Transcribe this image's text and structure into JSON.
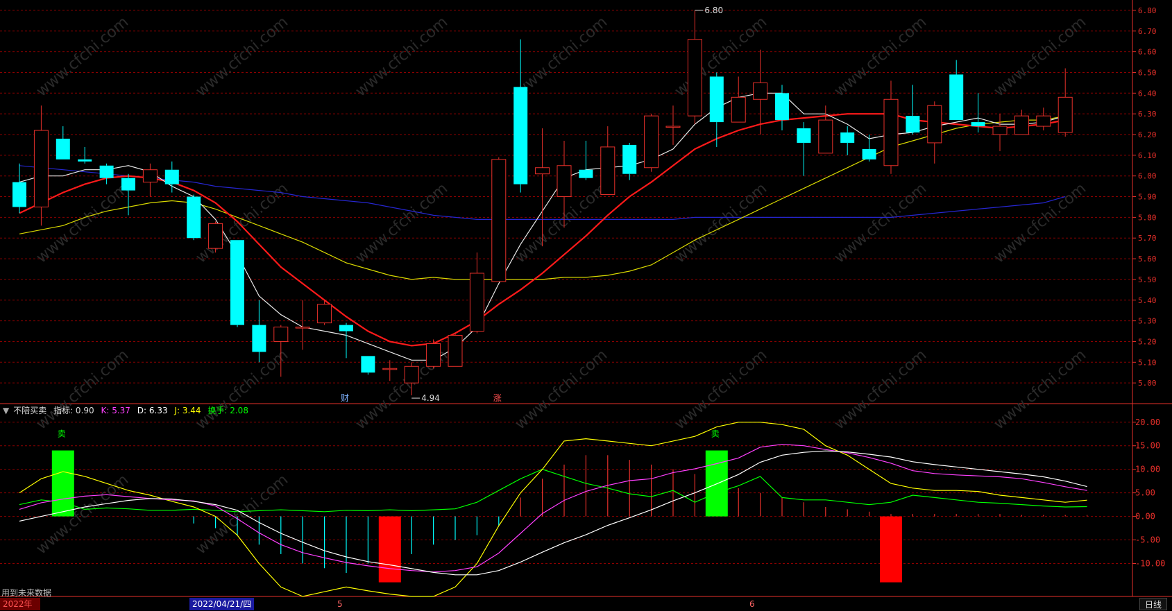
{
  "chart_data": [
    {
      "type": "candlestick",
      "ylim": [
        4.9,
        6.85
      ],
      "y_ticks": [
        5.0,
        5.1,
        5.2,
        5.3,
        5.4,
        5.5,
        5.6,
        5.7,
        5.8,
        5.9,
        6.0,
        6.1,
        6.2,
        6.3,
        6.4,
        6.5,
        6.6,
        6.7,
        6.8
      ],
      "candles": [
        {
          "o": 5.97,
          "h": 6.06,
          "l": 5.82,
          "c": 5.85
        },
        {
          "o": 5.85,
          "h": 6.34,
          "l": 5.76,
          "c": 6.22
        },
        {
          "o": 6.18,
          "h": 6.24,
          "l": 6.08,
          "c": 6.08
        },
        {
          "o": 6.08,
          "h": 6.14,
          "l": 6.06,
          "c": 6.07
        },
        {
          "o": 6.05,
          "h": 6.06,
          "l": 5.96,
          "c": 5.99
        },
        {
          "o": 5.99,
          "h": 6.01,
          "l": 5.81,
          "c": 5.93
        },
        {
          "o": 5.97,
          "h": 6.06,
          "l": 5.9,
          "c": 6.03
        },
        {
          "o": 6.03,
          "h": 6.07,
          "l": 5.92,
          "c": 5.96
        },
        {
          "o": 5.9,
          "h": 5.91,
          "l": 5.69,
          "c": 5.7
        },
        {
          "o": 5.65,
          "h": 5.78,
          "l": 5.63,
          "c": 5.77
        },
        {
          "o": 5.69,
          "h": 5.69,
          "l": 5.27,
          "c": 5.28
        },
        {
          "o": 5.28,
          "h": 5.4,
          "l": 5.1,
          "c": 5.15
        },
        {
          "o": 5.2,
          "h": 5.28,
          "l": 5.03,
          "c": 5.27
        },
        {
          "o": 5.27,
          "h": 5.4,
          "l": 5.16,
          "c": 5.27
        },
        {
          "o": 5.29,
          "h": 5.4,
          "l": 5.28,
          "c": 5.38
        },
        {
          "o": 5.28,
          "h": 5.29,
          "l": 5.12,
          "c": 5.25
        },
        {
          "o": 5.13,
          "h": 5.13,
          "l": 5.04,
          "c": 5.05
        },
        {
          "o": 5.07,
          "h": 5.11,
          "l": 5.01,
          "c": 5.07
        },
        {
          "o": 5.0,
          "h": 5.1,
          "l": 4.94,
          "c": 5.08
        },
        {
          "o": 5.08,
          "h": 5.21,
          "l": 5.07,
          "c": 5.19
        },
        {
          "o": 5.08,
          "h": 5.24,
          "l": 5.08,
          "c": 5.23
        },
        {
          "o": 5.25,
          "h": 5.63,
          "l": 5.24,
          "c": 5.53
        },
        {
          "o": 5.49,
          "h": 6.09,
          "l": 5.49,
          "c": 6.08
        },
        {
          "o": 6.43,
          "h": 6.66,
          "l": 5.92,
          "c": 5.96
        },
        {
          "o": 6.01,
          "h": 6.23,
          "l": 5.66,
          "c": 6.04
        },
        {
          "o": 5.9,
          "h": 6.17,
          "l": 5.75,
          "c": 6.05
        },
        {
          "o": 6.03,
          "h": 6.17,
          "l": 5.98,
          "c": 5.99
        },
        {
          "o": 5.91,
          "h": 6.24,
          "l": 5.91,
          "c": 6.14
        },
        {
          "o": 6.15,
          "h": 6.16,
          "l": 5.98,
          "c": 6.01
        },
        {
          "o": 6.04,
          "h": 6.3,
          "l": 6.02,
          "c": 6.29
        },
        {
          "o": 6.24,
          "h": 6.34,
          "l": 6.15,
          "c": 6.24
        },
        {
          "o": 6.29,
          "h": 6.8,
          "l": 6.25,
          "c": 6.66
        },
        {
          "o": 6.48,
          "h": 6.5,
          "l": 6.14,
          "c": 6.26
        },
        {
          "o": 6.26,
          "h": 6.48,
          "l": 6.26,
          "c": 6.38
        },
        {
          "o": 6.37,
          "h": 6.61,
          "l": 6.2,
          "c": 6.45
        },
        {
          "o": 6.4,
          "h": 6.44,
          "l": 6.22,
          "c": 6.27
        },
        {
          "o": 6.23,
          "h": 6.26,
          "l": 6.0,
          "c": 6.16
        },
        {
          "o": 6.11,
          "h": 6.34,
          "l": 6.11,
          "c": 6.27
        },
        {
          "o": 6.21,
          "h": 6.24,
          "l": 6.1,
          "c": 6.16
        },
        {
          "o": 6.13,
          "h": 6.2,
          "l": 6.07,
          "c": 6.08
        },
        {
          "o": 6.05,
          "h": 6.46,
          "l": 6.01,
          "c": 6.37
        },
        {
          "o": 6.29,
          "h": 6.44,
          "l": 6.2,
          "c": 6.21
        },
        {
          "o": 6.16,
          "h": 6.36,
          "l": 6.06,
          "c": 6.34
        },
        {
          "o": 6.49,
          "h": 6.56,
          "l": 6.27,
          "c": 6.27
        },
        {
          "o": 6.26,
          "h": 6.4,
          "l": 6.21,
          "c": 6.24
        },
        {
          "o": 6.2,
          "h": 6.3,
          "l": 6.12,
          "c": 6.24
        },
        {
          "o": 6.2,
          "h": 6.32,
          "l": 6.2,
          "c": 6.29
        },
        {
          "o": 6.24,
          "h": 6.33,
          "l": 6.22,
          "c": 6.29
        },
        {
          "o": 6.21,
          "h": 6.52,
          "l": 6.19,
          "c": 6.38
        }
      ],
      "ma_white": [
        5.97,
        6.0,
        6.0,
        6.03,
        6.03,
        6.05,
        6.02,
        5.95,
        5.9,
        5.79,
        5.62,
        5.42,
        5.33,
        5.27,
        5.25,
        5.23,
        5.19,
        5.15,
        5.11,
        5.11,
        5.17,
        5.27,
        5.48,
        5.67,
        5.83,
        5.99,
        6.03,
        6.04,
        6.05,
        6.08,
        6.13,
        6.25,
        6.33,
        6.38,
        6.4,
        6.4,
        6.3,
        6.3,
        6.25,
        6.18,
        6.2,
        6.21,
        6.24,
        6.26,
        6.28,
        6.25,
        6.25,
        6.26,
        6.29
      ],
      "ma_red": [
        5.82,
        5.87,
        5.92,
        5.96,
        5.99,
        6.0,
        5.99,
        5.97,
        5.93,
        5.87,
        5.78,
        5.67,
        5.56,
        5.48,
        5.4,
        5.32,
        5.25,
        5.2,
        5.18,
        5.19,
        5.24,
        5.3,
        5.38,
        5.45,
        5.53,
        5.62,
        5.71,
        5.81,
        5.9,
        5.97,
        6.05,
        6.13,
        6.18,
        6.22,
        6.25,
        6.27,
        6.28,
        6.29,
        6.3,
        6.3,
        6.3,
        6.27,
        6.26,
        6.25,
        6.24,
        6.23,
        6.24,
        6.25,
        6.27
      ],
      "ma_yellow": [
        5.72,
        5.74,
        5.76,
        5.8,
        5.83,
        5.85,
        5.87,
        5.88,
        5.87,
        5.84,
        5.8,
        5.76,
        5.72,
        5.68,
        5.63,
        5.58,
        5.55,
        5.52,
        5.5,
        5.51,
        5.5,
        5.5,
        5.5,
        5.5,
        5.5,
        5.51,
        5.51,
        5.52,
        5.54,
        5.57,
        5.63,
        5.69,
        5.74,
        5.79,
        5.84,
        5.89,
        5.94,
        5.99,
        6.04,
        6.09,
        6.14,
        6.17,
        6.2,
        6.23,
        6.25,
        6.26,
        6.27,
        6.27,
        6.29
      ],
      "ma_blue": [
        6.05,
        6.04,
        6.03,
        6.02,
        6.01,
        6.0,
        5.99,
        5.98,
        5.97,
        5.95,
        5.94,
        5.93,
        5.92,
        5.9,
        5.89,
        5.88,
        5.87,
        5.85,
        5.83,
        5.81,
        5.8,
        5.79,
        5.79,
        5.79,
        5.79,
        5.79,
        5.79,
        5.79,
        5.79,
        5.79,
        5.79,
        5.8,
        5.8,
        5.8,
        5.8,
        5.8,
        5.8,
        5.8,
        5.8,
        5.8,
        5.8,
        5.81,
        5.82,
        5.83,
        5.84,
        5.85,
        5.86,
        5.87,
        5.9
      ],
      "annotations": [
        {
          "label": "6.80",
          "index": 31
        },
        {
          "label": "4.94",
          "index": 18
        }
      ]
    },
    {
      "type": "indicator",
      "name": "不陪买卖",
      "ylim": [
        -17,
        21
      ],
      "y_ticks": [
        20.0,
        15.0,
        10.0,
        5.0,
        0.0,
        -5.0,
        -10.0
      ],
      "K": [
        1.5,
        2.9,
        3.7,
        4.3,
        4.6,
        4.2,
        3.8,
        3.5,
        3.3,
        2.2,
        -0.5,
        -3.5,
        -6.0,
        -7.7,
        -8.8,
        -9.8,
        -10.5,
        -11.1,
        -11.5,
        -11.8,
        -11.5,
        -10.7,
        -7.8,
        -3.6,
        0.6,
        3.4,
        5.3,
        6.6,
        7.6,
        8.0,
        9.3,
        10.1,
        11.2,
        12.4,
        14.7,
        15.3,
        15.0,
        14.2,
        13.5,
        12.5,
        11.3,
        9.7,
        9.1,
        8.8,
        8.6,
        8.4,
        8.0,
        7.2,
        6.3,
        5.5
      ],
      "D": [
        -1.0,
        0.0,
        1.0,
        2.0,
        2.7,
        3.4,
        3.8,
        3.7,
        3.2,
        2.5,
        1.3,
        -1.3,
        -3.6,
        -5.5,
        -7.3,
        -8.6,
        -9.6,
        -10.3,
        -11.1,
        -11.9,
        -12.4,
        -12.4,
        -11.5,
        -9.7,
        -7.6,
        -5.6,
        -3.9,
        -1.9,
        -0.3,
        1.4,
        3.3,
        5.0,
        6.9,
        8.9,
        11.5,
        13.0,
        13.6,
        13.9,
        13.7,
        13.2,
        12.6,
        11.6,
        11.0,
        10.5,
        10.0,
        9.5,
        9.0,
        8.4,
        7.5,
        6.33
      ],
      "J": [
        5.0,
        8.0,
        9.5,
        8.5,
        7.0,
        5.5,
        4.5,
        3.2,
        2.0,
        0.0,
        -4.0,
        -10.0,
        -15.0,
        -17.0,
        -16.0,
        -15.0,
        -15.8,
        -16.5,
        -17.0,
        -17.0,
        -15.0,
        -10.0,
        -2.0,
        5.0,
        10.0,
        16.0,
        16.5,
        16.0,
        15.5,
        15.0,
        16.0,
        17.0,
        19.0,
        20.0,
        20.0,
        19.5,
        18.5,
        15.0,
        13.0,
        10.0,
        7.0,
        6.0,
        5.5,
        5.5,
        5.3,
        4.5,
        4.0,
        3.5,
        3.0,
        3.44
      ],
      "turnover": [
        2.5,
        3.5,
        3.0,
        1.5,
        1.8,
        1.6,
        1.3,
        1.3,
        1.5,
        1.3,
        1.0,
        1.2,
        1.4,
        1.2,
        1.0,
        1.3,
        1.2,
        1.4,
        1.2,
        1.4,
        1.6,
        3.0,
        5.5,
        8.0,
        10.0,
        8.5,
        7.0,
        6.0,
        4.8,
        4.2,
        5.5,
        3.0,
        5.0,
        6.5,
        8.5,
        4.0,
        3.5,
        3.5,
        3.0,
        2.5,
        3.0,
        4.5,
        4.0,
        3.5,
        3.0,
        2.8,
        2.5,
        2.2,
        2.0,
        2.08
      ],
      "hist": [
        0,
        0,
        0,
        0,
        0,
        0,
        0,
        0,
        -1.5,
        -2.5,
        -4,
        -6,
        -8,
        -10,
        -11,
        -12,
        -10,
        -10,
        -8,
        -6,
        -5,
        -4,
        -2,
        4,
        8,
        11,
        13,
        13,
        12,
        11,
        10,
        9,
        7,
        6,
        5,
        4,
        3,
        2,
        1.5,
        1,
        0.5,
        0.5,
        0.5,
        0.5,
        0.5,
        0.5,
        0.3,
        0.3,
        0.3,
        0.3
      ],
      "signals": [
        {
          "type": "sell",
          "index": 2,
          "label": "卖"
        },
        {
          "type": "buy",
          "index": 17
        },
        {
          "type": "sell",
          "index": 32,
          "label": "卖"
        },
        {
          "type": "buy",
          "index": 40
        }
      ]
    }
  ],
  "legend": {
    "name": "不陪买卖",
    "indicator_label": "指标: 0.90",
    "k_label": "K: 5.37",
    "d_label": "D: 6.33",
    "j_label": "J: 3.44",
    "turnover_label": "换手: 2.08",
    "colors": {
      "K": "#ff40ff",
      "D": "#ffffff",
      "J": "#ffff00",
      "turnover": "#00ff00",
      "buy": "#ff0000",
      "sell": "#00ff00"
    }
  },
  "markers": [
    {
      "label": "财",
      "index": 15
    },
    {
      "label": "涨",
      "index": 22
    }
  ],
  "bottom_bar": {
    "year": "2022年",
    "date": "2022/04/21/四",
    "tick_5": "5",
    "tick_6": "6",
    "period": "日线",
    "note": "用到未来数据"
  },
  "watermark": "www.cfchi.com",
  "colors": {
    "up": "#e8302a",
    "down": "#00ffff",
    "ma_white": "#e8e8e8",
    "ma_red": "#ff1a1a",
    "ma_yellow": "#d8d800",
    "ma_blue": "#2626d0",
    "grid": "#8b0000"
  }
}
